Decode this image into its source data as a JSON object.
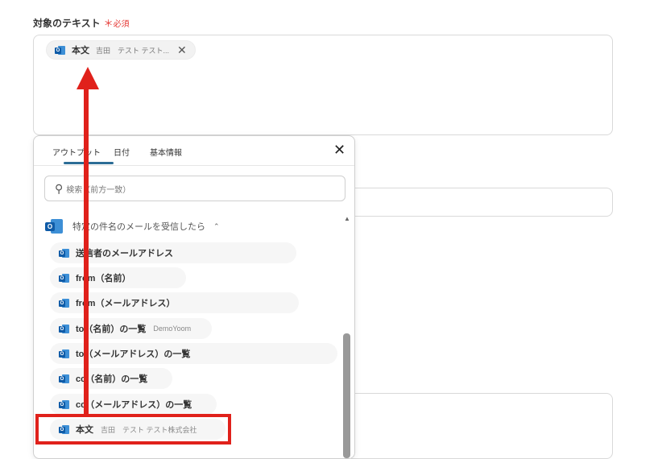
{
  "field": {
    "label": "対象のテキスト",
    "required_star": "＊",
    "required_text": "必須"
  },
  "chip": {
    "main": "本文",
    "sub": "吉田　テスト テスト..."
  },
  "popup": {
    "tabs": [
      "アウトプット",
      "日付",
      "基本情報"
    ],
    "search_placeholder": "検索（前方一致）",
    "section_title": "特定の件名のメールを受信したら",
    "items": [
      {
        "label": "送信者のメールアドレス",
        "sub": ""
      },
      {
        "label": "from（名前）",
        "sub": ""
      },
      {
        "label": "from（メールアドレス）",
        "sub": ""
      },
      {
        "label": "to（名前）の一覧",
        "sub": "DemoYoom"
      },
      {
        "label": "to（メールアドレス）の一覧",
        "sub": ""
      },
      {
        "label": "cc（名前）の一覧",
        "sub": ""
      },
      {
        "label": "cc（メールアドレス）の一覧",
        "sub": ""
      },
      {
        "label": "本文",
        "sub": "吉田　テスト テスト株式会社"
      }
    ]
  },
  "colors": {
    "accent": "#2c6d96",
    "annotation_red": "#e0211b",
    "outlook_blue": "#0f5ba7"
  }
}
